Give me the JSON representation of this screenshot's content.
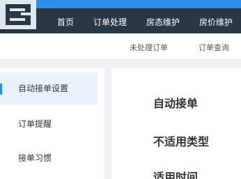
{
  "nav": {
    "items": [
      {
        "label": "首页"
      },
      {
        "label": "订单处理"
      },
      {
        "label": "房态维护"
      },
      {
        "label": "房价维护"
      }
    ]
  },
  "subnav": {
    "items": [
      {
        "label": "未处理订单"
      },
      {
        "label": "订单查询"
      }
    ]
  },
  "sidebar": {
    "items": [
      {
        "label": "自动接单设置",
        "active": true
      },
      {
        "label": "订单提醒"
      },
      {
        "label": "接单习惯"
      }
    ]
  },
  "content": {
    "sections": [
      {
        "title": "自动接单"
      },
      {
        "title": "不适用类型"
      },
      {
        "title": "适用时间"
      }
    ]
  },
  "colors": {
    "accent": "#2d8de6",
    "header": "#2a3846"
  },
  "icons": {
    "logo": "cube-logo-icon"
  }
}
